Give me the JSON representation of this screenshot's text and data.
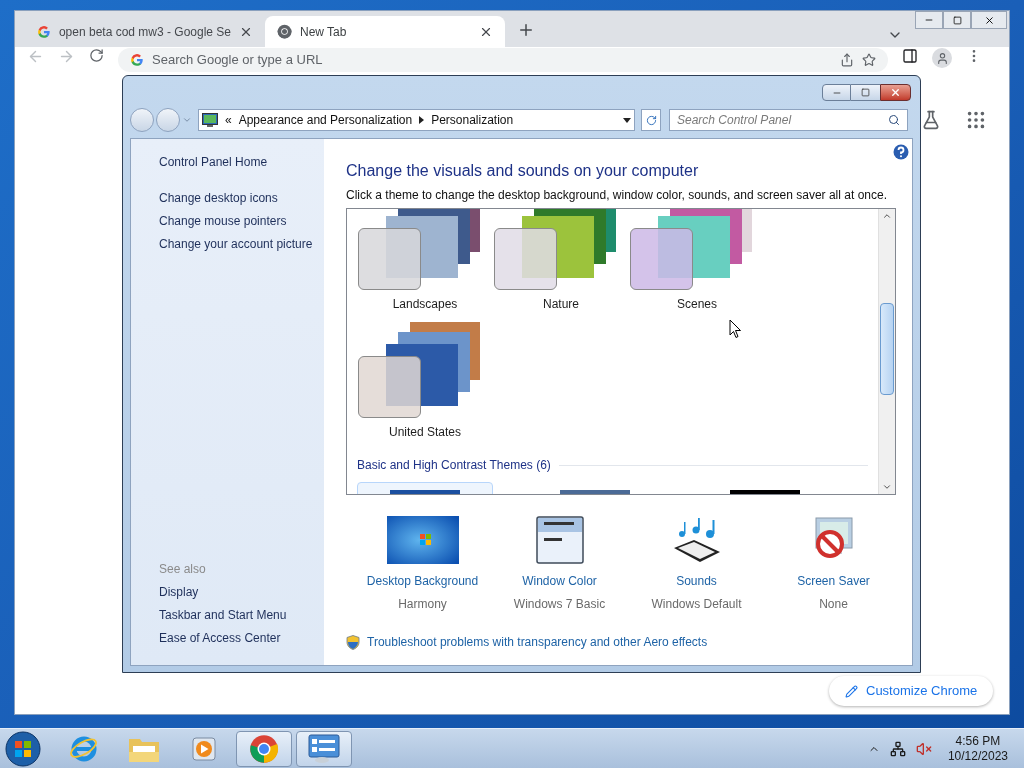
{
  "chrome": {
    "tabs": [
      {
        "title": "open beta cod mw3 - Google Se",
        "selected": false
      },
      {
        "title": "New Tab",
        "selected": true
      }
    ],
    "omnibox": {
      "placeholder": "Search Google or type a URL"
    },
    "customize_button": "Customize Chrome"
  },
  "control_panel": {
    "breadcrumb_overflow": "«",
    "breadcrumbs": [
      "Appearance and Personalization",
      "Personalization"
    ],
    "search": {
      "placeholder": "Search Control Panel"
    },
    "sidebar": {
      "home": "Control Panel Home",
      "links": [
        "Change desktop icons",
        "Change mouse pointers",
        "Change your account picture"
      ],
      "see_also_heading": "See also",
      "see_also": [
        "Display",
        "Taskbar and Start Menu",
        "Ease of Access Center"
      ]
    },
    "heading": "Change the visuals and sounds on your computer",
    "description": "Click a theme to change the desktop background, window color, sounds, and screen saver all at once.",
    "themes": [
      {
        "name": "Landscapes"
      },
      {
        "name": "Nature"
      },
      {
        "name": "Scenes"
      },
      {
        "name": "United States"
      }
    ],
    "theme_group": "Basic and High Contrast Themes (6)",
    "basic_themes": [
      {
        "selected": true
      },
      {
        "selected": false
      },
      {
        "selected": false
      }
    ],
    "settings": [
      {
        "kind": "background",
        "label": "Desktop Background",
        "value": "Harmony"
      },
      {
        "kind": "color",
        "label": "Window Color",
        "value": "Windows 7 Basic"
      },
      {
        "kind": "sound",
        "label": "Sounds",
        "value": "Windows Default"
      },
      {
        "kind": "screensaver",
        "label": "Screen Saver",
        "value": "None"
      }
    ],
    "troubleshoot_link": "Troubleshoot problems with transparency and other Aero effects"
  },
  "taskbar": {
    "apps": [
      {
        "kind": "ie",
        "active": false
      },
      {
        "kind": "explorer",
        "active": false
      },
      {
        "kind": "media",
        "active": false
      },
      {
        "kind": "chrome",
        "active": true
      },
      {
        "kind": "control",
        "active": true
      }
    ],
    "clock": {
      "time": "4:56 PM",
      "date": "10/12/2023"
    }
  }
}
